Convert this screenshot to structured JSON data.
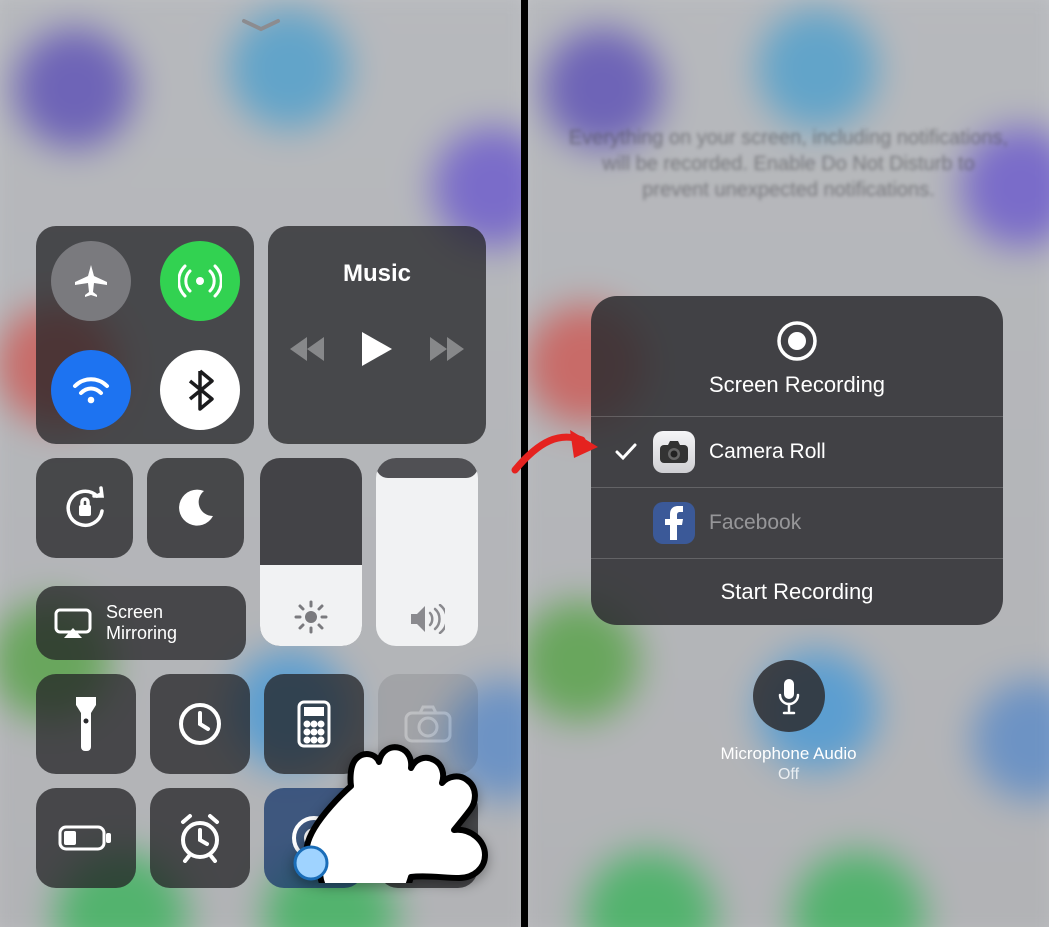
{
  "left": {
    "music_label": "Music",
    "screen_mirroring_label": "Screen\nMirroring",
    "brightness_percent": 43,
    "volume_percent": 92
  },
  "right": {
    "warning_text": "Everything on your screen, including notifications, will be recorded. Enable Do Not Disturb to prevent unexpected notifications.",
    "title": "Screen Recording",
    "option_camera_roll": "Camera Roll",
    "option_facebook": "Facebook",
    "start_label": "Start Recording",
    "mic_label": "Microphone Audio",
    "mic_state": "Off"
  },
  "colors": {
    "arrow": "#e5221f",
    "facebook": "#3b5998"
  }
}
